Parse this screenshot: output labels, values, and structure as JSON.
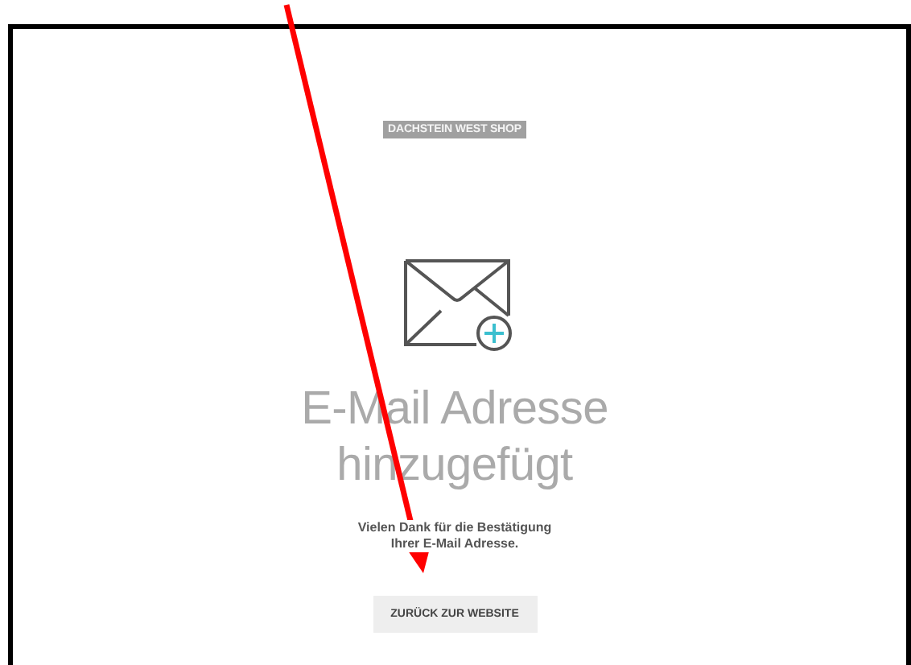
{
  "brand": "DACHSTEIN WEST SHOP",
  "heading": [
    "E-Mail Adresse",
    "hinzugefügt"
  ],
  "message": [
    "Vielen Dank für die Bestätigung",
    "Ihrer E-Mail Adresse."
  ],
  "button": "ZURÜCK ZUR WEBSITE"
}
